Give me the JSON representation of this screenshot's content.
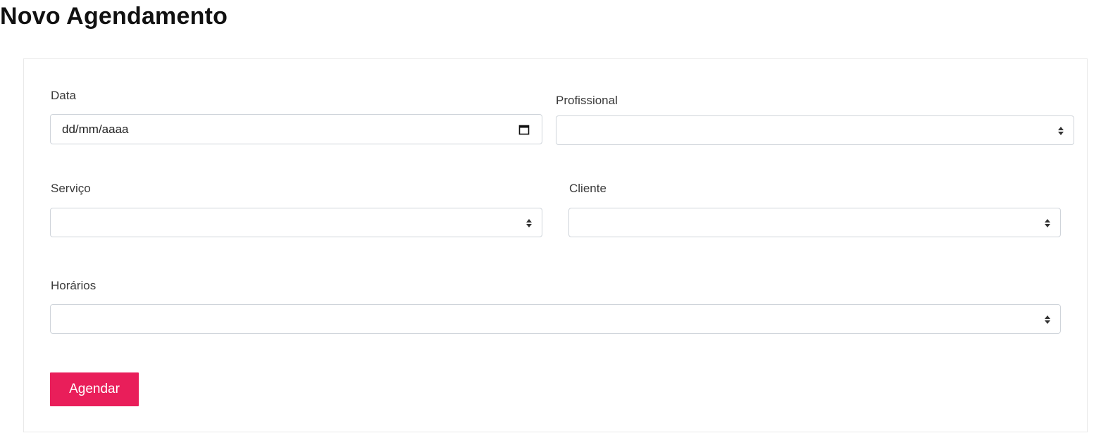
{
  "page": {
    "title": "Novo Agendamento"
  },
  "form": {
    "data": {
      "label": "Data",
      "placeholder": "dd/mm/aaaa",
      "icon": "calendar-icon"
    },
    "profissional": {
      "label": "Profissional",
      "value": "",
      "icon": "sort-icon"
    },
    "servico": {
      "label": "Serviço",
      "value": "",
      "icon": "sort-icon"
    },
    "cliente": {
      "label": "Cliente",
      "value": "",
      "icon": "sort-icon"
    },
    "horarios": {
      "label": "Horários",
      "value": "",
      "icon": "sort-icon"
    },
    "submit_label": "Agendar"
  },
  "colors": {
    "accent": "#e91e5a",
    "border": "#cfd4da",
    "card_border": "#e9e9e9"
  }
}
